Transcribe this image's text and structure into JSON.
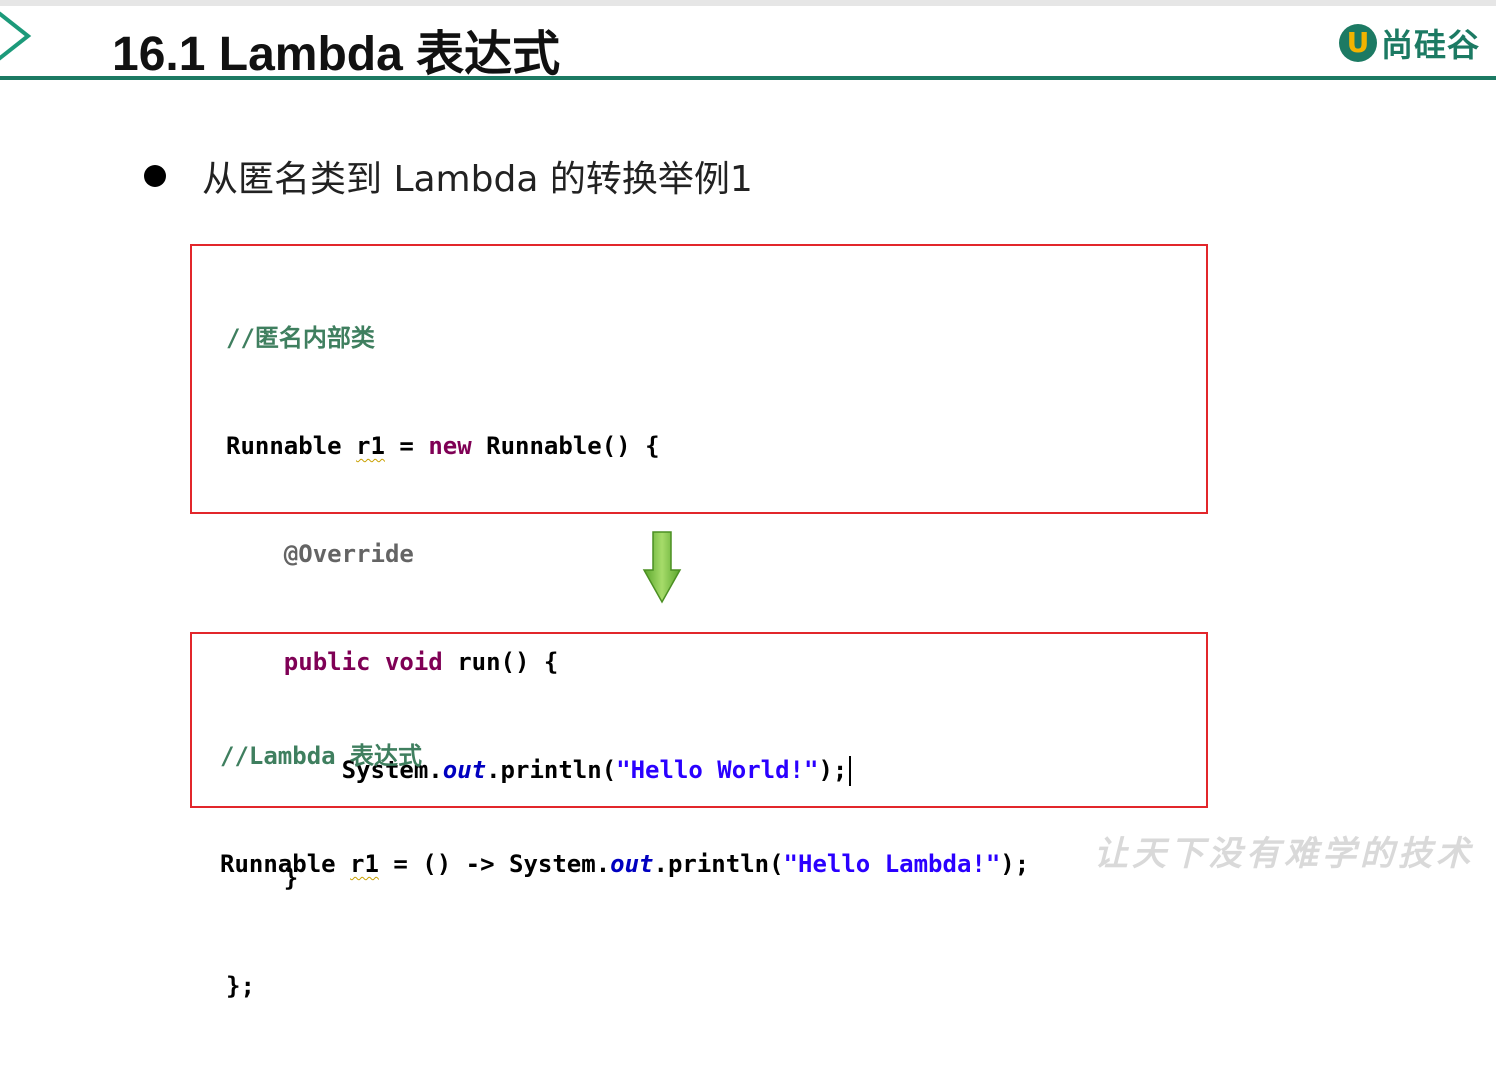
{
  "slide": {
    "title": "16.1 Lambda 表达式",
    "brand_letter": "U",
    "brand_name": "尚硅谷",
    "bullet": "从匿名类到 Lambda 的转换举例1",
    "slogan": "让天下没有难学的技术"
  },
  "anonymous_code": {
    "line1": "//匿名内部类",
    "line2": {
      "type": "Runnable ",
      "var": "r1",
      "eq": " = ",
      "kw_new": "new",
      "rest": " Runnable() {"
    },
    "line3": "@Override",
    "line4": {
      "kw_public": "public",
      "sp": " ",
      "kw_void": "void",
      "rest": " run() {"
    },
    "line5": {
      "a": "System.",
      "field": "out",
      "b": ".println(",
      "str": "\"Hello World!\"",
      "c": ");"
    },
    "line6": "}",
    "line7": "};"
  },
  "lambda_code": {
    "line1": "//Lambda 表达式",
    "line2": {
      "type": "Runnable ",
      "var": "r1",
      "a": " = () -> System.",
      "field": "out",
      "b": ".println(",
      "str": "\"Hello Lambda!\"",
      "c": ");"
    }
  },
  "colors": {
    "accent_green": "#1c7a63",
    "box_border": "#e2262b",
    "arrow_green": "#7cc242"
  }
}
